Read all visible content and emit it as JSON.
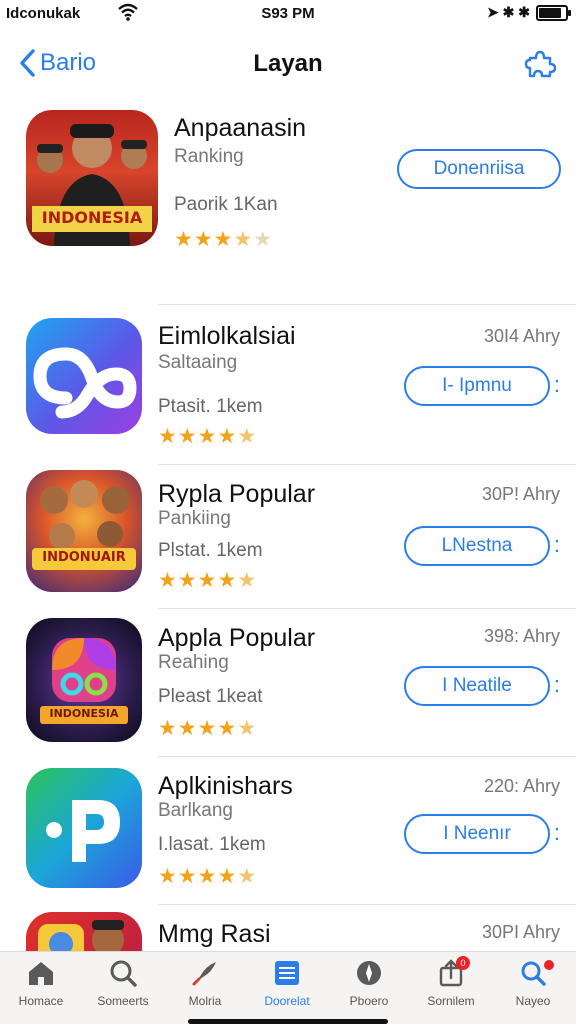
{
  "status": {
    "carrier": "Idconukak",
    "time": "S93 PM",
    "right_glyphs": "➤ ✱ ✱"
  },
  "nav": {
    "back_label": "Bario",
    "title": "Layan"
  },
  "apps": [
    {
      "name": "Anpaanasin",
      "subtitle": "Ranking",
      "meta": "Paorik 1Kan",
      "size": "",
      "button": "Donenriisa",
      "rating": 3.5,
      "icon_text": "INDONESIA"
    },
    {
      "name": "Eimlolkalsiai",
      "subtitle": "Saltaaing",
      "meta": "Ptasit. 1kem",
      "size": "30I4 Ahry",
      "button": "I- Ipmnu",
      "rating": 4.5,
      "icon_text": ""
    },
    {
      "name": "Rypla Popular",
      "subtitle": "Pankiing",
      "meta": "Plstat. 1kem",
      "size": "30P! Ahry",
      "button": "LNestna",
      "rating": 4.5,
      "icon_text": "INDONUAIR"
    },
    {
      "name": "Appla Popular",
      "subtitle": "Reahing",
      "meta": "Pleast 1keat",
      "size": "398: Ahry",
      "button": "I Neatile",
      "rating": 4.5,
      "icon_text": "INDONESIA"
    },
    {
      "name": "Aplkinishars",
      "subtitle": "Barlkang",
      "meta": "I.lasat. 1kem",
      "size": "220: Ahry",
      "button": "I Neenır",
      "rating": 4.5,
      "icon_text": ""
    },
    {
      "name": "Mmg Rasi",
      "subtitle": "",
      "meta": "",
      "size": "30PI Ahry",
      "button": "",
      "rating": 0,
      "icon_text": ""
    }
  ],
  "row_more_glyph": ":",
  "tabs": [
    {
      "label": "Homace",
      "icon": "home-icon"
    },
    {
      "label": "Someerts",
      "icon": "search-icon"
    },
    {
      "label": "Molria",
      "icon": "rocket-icon"
    },
    {
      "label": "Doorelat",
      "icon": "apps-list-icon"
    },
    {
      "label": "Pboero",
      "icon": "compass-icon"
    },
    {
      "label": "Sornilem",
      "icon": "updates-icon",
      "badge": "0"
    },
    {
      "label": "Nayeo",
      "icon": "search-person-icon"
    }
  ],
  "colors": {
    "accent": "#2b7de9",
    "star": "#f3a31a",
    "badge": "#e22222"
  }
}
